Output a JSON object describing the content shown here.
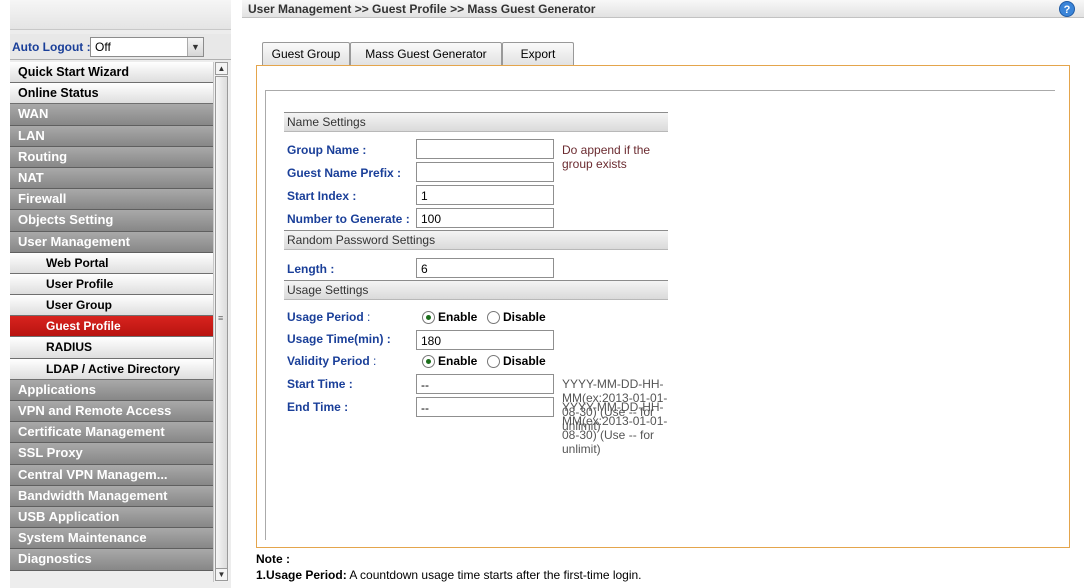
{
  "sidebar": {
    "auto_logout_label": "Auto Logout :",
    "auto_logout_value": "Off",
    "items": [
      {
        "label": "Quick Start Wizard",
        "kind": "white"
      },
      {
        "label": "Online Status",
        "kind": "white"
      },
      {
        "label": "WAN",
        "kind": "gray"
      },
      {
        "label": "LAN",
        "kind": "gray"
      },
      {
        "label": "Routing",
        "kind": "gray"
      },
      {
        "label": "NAT",
        "kind": "gray"
      },
      {
        "label": "Firewall",
        "kind": "gray"
      },
      {
        "label": "Objects Setting",
        "kind": "gray"
      },
      {
        "label": "User Management",
        "kind": "gray"
      },
      {
        "label": "Web Portal",
        "kind": "sub"
      },
      {
        "label": "User Profile",
        "kind": "sub"
      },
      {
        "label": "User Group",
        "kind": "sub"
      },
      {
        "label": "Guest Profile",
        "kind": "active"
      },
      {
        "label": "RADIUS",
        "kind": "sub"
      },
      {
        "label": "LDAP / Active Directory",
        "kind": "sub"
      },
      {
        "label": "Applications",
        "kind": "gray"
      },
      {
        "label": "VPN and Remote Access",
        "kind": "gray"
      },
      {
        "label": "Certificate Management",
        "kind": "gray"
      },
      {
        "label": "SSL Proxy",
        "kind": "gray"
      },
      {
        "label": "Central VPN Managem...",
        "kind": "gray"
      },
      {
        "label": "Bandwidth Management",
        "kind": "gray"
      },
      {
        "label": "USB Application",
        "kind": "gray"
      },
      {
        "label": "System Maintenance",
        "kind": "gray"
      },
      {
        "label": "Diagnostics",
        "kind": "gray"
      }
    ]
  },
  "header": {
    "breadcrumb": "User Management >> Guest Profile >> Mass Guest Generator",
    "help": "?"
  },
  "tabs": [
    {
      "label": "Guest Group"
    },
    {
      "label": "Mass Guest Generator"
    },
    {
      "label": "Export"
    }
  ],
  "form": {
    "name_settings": "Name Settings",
    "group_name_label": "Group Name :",
    "group_name_value": "",
    "group_name_hint": "Do append if the group exists",
    "prefix_label": "Guest Name Prefix :",
    "prefix_value": "",
    "start_index_label": "Start Index :",
    "start_index_value": "1",
    "number_label": "Number to Generate :",
    "number_value": "100",
    "random_password": "Random Password Settings",
    "length_label": "Length :",
    "length_value": "6",
    "usage_settings": "Usage Settings",
    "usage_period_label": "Usage Period",
    "usage_period_colon": " :",
    "enable": "Enable",
    "disable": "Disable",
    "usage_time_label": "Usage Time(min) :",
    "usage_time_value": "180",
    "validity_label": "Validity Period",
    "validity_colon": " :",
    "start_time_label": "Start Time :",
    "start_time_value": "--",
    "end_time_label": "End Time :",
    "end_time_value": "--",
    "time_hint": "YYYY-MM-DD-HH-MM(ex:2013-01-01-08-30) (Use -- for unlimit)"
  },
  "note": {
    "title": "Note :",
    "line1_bold": "1.Usage Period:",
    "line1_text": " A countdown usage time starts after the first-time login."
  }
}
